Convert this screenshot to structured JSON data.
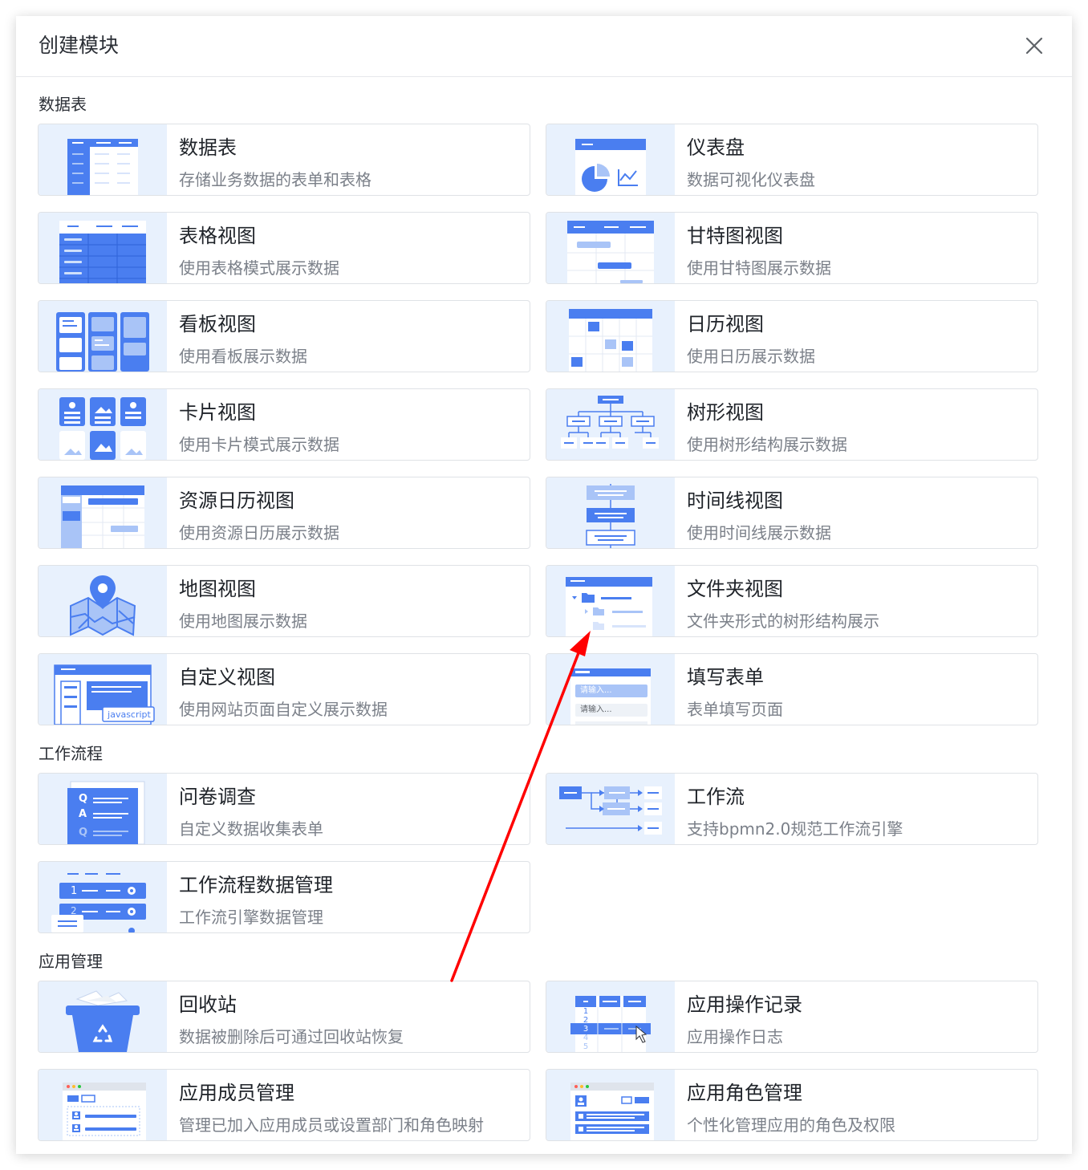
{
  "dialog": {
    "title": "创建模块"
  },
  "sections": {
    "data_table": "数据表",
    "workflow": "工作流程",
    "app_management": "应用管理"
  },
  "cards": {
    "data_table": {
      "title": "数据表",
      "desc": "存储业务数据的表单和表格",
      "icon": "table-icon"
    },
    "dashboard": {
      "title": "仪表盘",
      "desc": "数据可视化仪表盘",
      "icon": "dashboard-icon"
    },
    "grid_view": {
      "title": "表格视图",
      "desc": "使用表格模式展示数据",
      "icon": "grid-icon"
    },
    "gantt_view": {
      "title": "甘特图视图",
      "desc": "使用甘特图展示数据",
      "icon": "gantt-icon"
    },
    "kanban_view": {
      "title": "看板视图",
      "desc": "使用看板展示数据",
      "icon": "kanban-icon"
    },
    "calendar_view": {
      "title": "日历视图",
      "desc": "使用日历展示数据",
      "icon": "calendar-icon"
    },
    "card_view": {
      "title": "卡片视图",
      "desc": "使用卡片模式展示数据",
      "icon": "card-icon"
    },
    "tree_view": {
      "title": "树形视图",
      "desc": "使用树形结构展示数据",
      "icon": "tree-icon"
    },
    "resource_calendar_view": {
      "title": "资源日历视图",
      "desc": "使用资源日历展示数据",
      "icon": "resource-calendar-icon"
    },
    "timeline_view": {
      "title": "时间线视图",
      "desc": "使用时间线展示数据",
      "icon": "timeline-icon"
    },
    "map_view": {
      "title": "地图视图",
      "desc": "使用地图展示数据",
      "icon": "map-pin-icon"
    },
    "folder_view": {
      "title": "文件夹视图",
      "desc": "文件夹形式的树形结构展示",
      "icon": "folder-icon"
    },
    "custom_view": {
      "title": "自定义视图",
      "desc": "使用网站页面自定义展示数据",
      "icon": "code-window-icon",
      "thumb_label": "javascript"
    },
    "form_fill": {
      "title": "填写表单",
      "desc": "表单填写页面",
      "icon": "form-icon",
      "thumb_placeholder": "请输入..."
    },
    "survey": {
      "title": "问卷调查",
      "desc": "自定义数据收集表单",
      "icon": "survey-icon",
      "thumb_q": "Q",
      "thumb_a": "A"
    },
    "workflow": {
      "title": "工作流",
      "desc": "支持bpmn2.0规范工作流引擎",
      "icon": "workflow-icon"
    },
    "workflow_data": {
      "title": "工作流程数据管理",
      "desc": "工作流引擎数据管理",
      "icon": "workflow-data-icon",
      "thumb_row1": "1",
      "thumb_row2": "2"
    },
    "recycle_bin": {
      "title": "回收站",
      "desc": "数据被删除后可通过回收站恢复",
      "icon": "recycle-bin-icon"
    },
    "operation_log": {
      "title": "应用操作记录",
      "desc": "应用操作日志",
      "icon": "log-icon",
      "thumb_rows": [
        "1",
        "2",
        "3",
        "4",
        "5"
      ]
    },
    "member_management": {
      "title": "应用成员管理",
      "desc": "管理已加入应用成员或设置部门和角色映射",
      "icon": "members-icon"
    },
    "role_management": {
      "title": "应用角色管理",
      "desc": "个性化管理应用的角色及权限",
      "icon": "roles-icon"
    }
  },
  "colors": {
    "accent": "#4a7ef0",
    "accent_light": "#a9c4f7",
    "thumb_bg": "#e8f1fd",
    "annotation_arrow": "#ff0000"
  }
}
